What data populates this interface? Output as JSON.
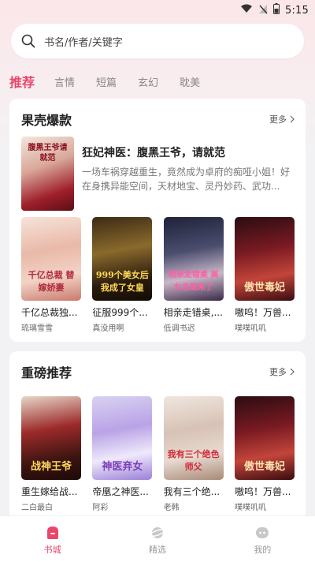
{
  "status_bar": {
    "time": "5:15"
  },
  "search": {
    "placeholder": "书名/作者/关键字"
  },
  "tabs": [
    {
      "label": "推荐",
      "active": true
    },
    {
      "label": "言情"
    },
    {
      "label": "短篇"
    },
    {
      "label": "玄幻"
    },
    {
      "label": "耽美"
    }
  ],
  "section1": {
    "title": "果壳爆款",
    "more": "更多",
    "featured": {
      "title": "狂妃神医：腹黑王爷，请就范",
      "desc": "一场车祸穿越重生，竟然成为卓府的痴哑小姐！好在身携异能空间，天材地宝、灵丹妙药、武功...",
      "cover_text": "腹黑王爷请就范"
    },
    "books": [
      {
        "title": "千亿总裁独...",
        "author": "琉璃雪雪",
        "cover_text": "千亿总裁 替嫁娇妻"
      },
      {
        "title": "征服999个...",
        "author": "真没用啊",
        "cover_text": "999个美女后 我成了女皇"
      },
      {
        "title": "相亲走错桌,...",
        "author": "低调书迟",
        "cover_text": "相亲走错桌 美女总裁来了"
      },
      {
        "title": "嗷呜！万兽...",
        "author": "噗噗叽叽",
        "cover_text": "傲世毒妃"
      }
    ]
  },
  "section2": {
    "title": "重磅推荐",
    "more": "更多",
    "books": [
      {
        "title": "重生嫁给战...",
        "author": "二白最白",
        "cover_text": "战神王爷"
      },
      {
        "title": "帝凰之神医...",
        "author": "阿彩",
        "cover_text": "神医弃女"
      },
      {
        "title": "我有三个绝...",
        "author": "老韩",
        "cover_text": "我有三个绝色师父"
      },
      {
        "title": "嗷呜！万兽...",
        "author": "噗噗叽叽",
        "cover_text": "傲世毒妃"
      }
    ]
  },
  "bottom_nav": [
    {
      "label": "书城",
      "icon": "bookstore-icon",
      "active": true
    },
    {
      "label": "精选",
      "icon": "planet-icon"
    },
    {
      "label": "我的",
      "icon": "profile-icon"
    }
  ],
  "colors": {
    "accent": "#e8476a",
    "background": "#f2f2f4"
  }
}
